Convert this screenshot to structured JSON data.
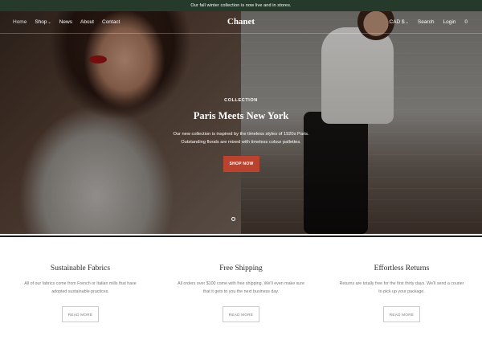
{
  "announcement": "Our fall winter collection is now live and in stores.",
  "nav": {
    "left": [
      "Home",
      "Shop",
      "News",
      "About",
      "Contact"
    ],
    "logo": "Chanet",
    "currency": "CAD $",
    "search": "Search",
    "login": "Login",
    "cart_count": "0"
  },
  "hero": {
    "eyebrow": "COLLECTION",
    "title": "Paris Meets New York",
    "copy_line1": "Our new collection is inspired by the timeless styles of 1920s Paris.",
    "copy_line2": "Outstanding florals are mixed with timeless colour pallettes.",
    "button": "SHOP NOW"
  },
  "features": [
    {
      "title": "Sustainable Fabrics",
      "desc": "All of our fabrics come from French or Italian mills that have adopted sustainable practices.",
      "button": "READ MORE"
    },
    {
      "title": "Free Shipping",
      "desc": "All orders over $100 come with free shipping. We'll even make sure that it gets to you the next business day.",
      "button": "READ MORE"
    },
    {
      "title": "Effortless Returns",
      "desc": "Returns are totally free for the first thirty days. We'll send a courier to pick up your package.",
      "button": "READ MORE"
    }
  ],
  "colors": {
    "announcement_bg": "#263a2c",
    "accent": "#b9432f"
  }
}
